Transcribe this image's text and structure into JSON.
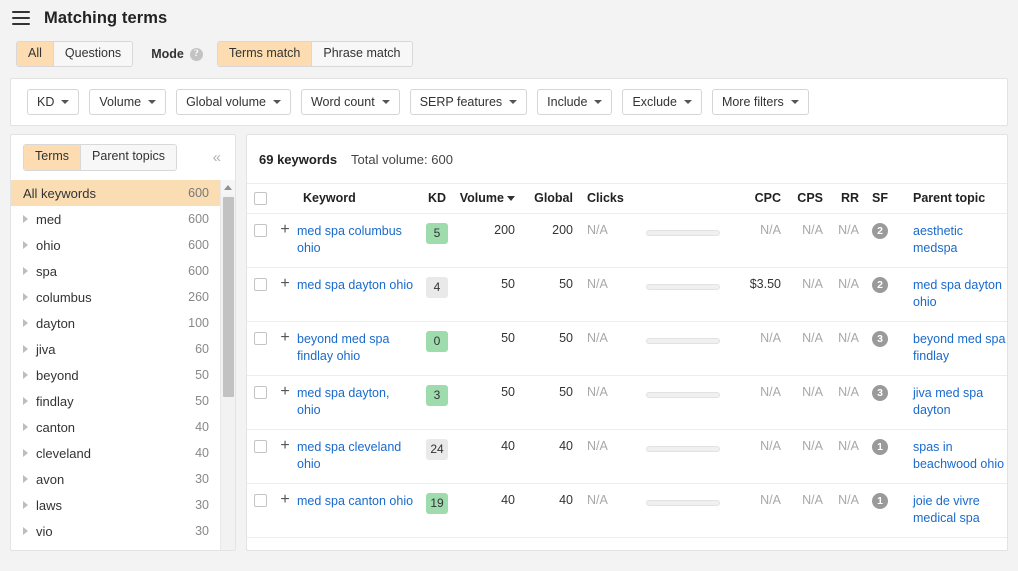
{
  "header": {
    "menu_icon": "hamburger-icon",
    "title": "Matching terms"
  },
  "mode_row": {
    "scope_tabs": [
      {
        "label": "All",
        "active": true
      },
      {
        "label": "Questions",
        "active": false
      }
    ],
    "mode_label": "Mode",
    "help_icon": "question-mark-icon",
    "match_tabs": [
      {
        "label": "Terms match",
        "active": true
      },
      {
        "label": "Phrase match",
        "active": false
      }
    ]
  },
  "filters": [
    {
      "label": "KD"
    },
    {
      "label": "Volume"
    },
    {
      "label": "Global volume"
    },
    {
      "label": "Word count"
    },
    {
      "label": "SERP features"
    },
    {
      "label": "Include"
    },
    {
      "label": "Exclude"
    },
    {
      "label": "More filters"
    }
  ],
  "sidebar": {
    "tabs": [
      {
        "label": "Terms",
        "active": true
      },
      {
        "label": "Parent topics",
        "active": false
      }
    ],
    "collapse_icon": "chevron-double-left-icon",
    "items": [
      {
        "label": "All keywords",
        "count": "600",
        "active": true,
        "expandable": false
      },
      {
        "label": "med",
        "count": "600",
        "active": false,
        "expandable": true
      },
      {
        "label": "ohio",
        "count": "600",
        "active": false,
        "expandable": true
      },
      {
        "label": "spa",
        "count": "600",
        "active": false,
        "expandable": true
      },
      {
        "label": "columbus",
        "count": "260",
        "active": false,
        "expandable": true
      },
      {
        "label": "dayton",
        "count": "100",
        "active": false,
        "expandable": true
      },
      {
        "label": "jiva",
        "count": "60",
        "active": false,
        "expandable": true
      },
      {
        "label": "beyond",
        "count": "50",
        "active": false,
        "expandable": true
      },
      {
        "label": "findlay",
        "count": "50",
        "active": false,
        "expandable": true
      },
      {
        "label": "canton",
        "count": "40",
        "active": false,
        "expandable": true
      },
      {
        "label": "cleveland",
        "count": "40",
        "active": false,
        "expandable": true
      },
      {
        "label": "avon",
        "count": "30",
        "active": false,
        "expandable": true
      },
      {
        "label": "laws",
        "count": "30",
        "active": false,
        "expandable": true
      },
      {
        "label": "vio",
        "count": "30",
        "active": false,
        "expandable": true
      }
    ]
  },
  "main": {
    "summary": {
      "keyword_count": "69 keywords",
      "total_volume": "Total volume: 600"
    },
    "columns": [
      {
        "key": "keyword",
        "label": "Keyword"
      },
      {
        "key": "kd",
        "label": "KD"
      },
      {
        "key": "volume",
        "label": "Volume",
        "sorted": true
      },
      {
        "key": "global",
        "label": "Global"
      },
      {
        "key": "clicks",
        "label": "Clicks"
      },
      {
        "key": "cpc",
        "label": "CPC"
      },
      {
        "key": "cps",
        "label": "CPS"
      },
      {
        "key": "rr",
        "label": "RR"
      },
      {
        "key": "sf",
        "label": "SF"
      },
      {
        "key": "parent_topic",
        "label": "Parent topic"
      }
    ],
    "rows": [
      {
        "keyword": "med spa columbus ohio",
        "kd": "5",
        "kd_color": "green",
        "volume": "200",
        "global": "200",
        "clicks": "N/A",
        "cpc": "N/A",
        "cps": "N/A",
        "rr": "N/A",
        "sf": "2",
        "parent_topic": "aesthetic medspa"
      },
      {
        "keyword": "med spa dayton ohio",
        "kd": "4",
        "kd_color": "gray",
        "volume": "50",
        "global": "50",
        "clicks": "N/A",
        "cpc": "$3.50",
        "cps": "N/A",
        "rr": "N/A",
        "sf": "2",
        "parent_topic": "med spa dayton ohio"
      },
      {
        "keyword": "beyond med spa findlay ohio",
        "kd": "0",
        "kd_color": "green",
        "volume": "50",
        "global": "50",
        "clicks": "N/A",
        "cpc": "N/A",
        "cps": "N/A",
        "rr": "N/A",
        "sf": "3",
        "parent_topic": "beyond med spa findlay"
      },
      {
        "keyword": "med spa dayton, ohio",
        "kd": "3",
        "kd_color": "green",
        "volume": "50",
        "global": "50",
        "clicks": "N/A",
        "cpc": "N/A",
        "cps": "N/A",
        "rr": "N/A",
        "sf": "3",
        "parent_topic": "jiva med spa dayton"
      },
      {
        "keyword": "med spa cleveland ohio",
        "kd": "24",
        "kd_color": "gray",
        "volume": "40",
        "global": "40",
        "clicks": "N/A",
        "cpc": "N/A",
        "cps": "N/A",
        "rr": "N/A",
        "sf": "1",
        "parent_topic": "spas in beachwood ohio"
      },
      {
        "keyword": "med spa canton ohio",
        "kd": "19",
        "kd_color": "green",
        "volume": "40",
        "global": "40",
        "clicks": "N/A",
        "cpc": "N/A",
        "cps": "N/A",
        "rr": "N/A",
        "sf": "1",
        "parent_topic": "joie de vivre medical spa"
      }
    ]
  },
  "colors": {
    "accent_orange": "#fcdcb0",
    "kd_green": "#9edcae",
    "kd_gray": "#e9e9e9",
    "link_blue": "#1a6acb",
    "sf_badge_gray": "#9a9a9a"
  }
}
